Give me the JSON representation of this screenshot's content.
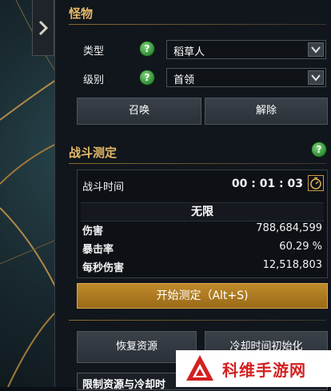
{
  "monster": {
    "title": "怪物",
    "type_label": "类型",
    "type_value": "稻草人",
    "level_label": "级别",
    "level_value": "首领",
    "help_glyph": "?",
    "summon_label": "召唤",
    "dismiss_label": "解除"
  },
  "combat": {
    "title": "战斗测定",
    "help_glyph": "?",
    "time_label": "战斗时间",
    "time_value": "00 : 01 : 03",
    "mode": "无限",
    "damage_label": "伤害",
    "damage_value": "788,684,599",
    "crit_label": "暴击率",
    "crit_value": "60.29 %",
    "dps_label": "每秒伤害",
    "dps_value": "12,518,803",
    "start_label": "开始测定（Alt+S)"
  },
  "actions": {
    "restore_label": "恢复资源",
    "cooldown_label": "冷却时间初始化",
    "limit_label": "限制资源与冷却时"
  },
  "watermark": {
    "text": "科维手游网"
  },
  "colors": {
    "accent": "#e7b968",
    "gold_button": "#b07e22",
    "help_green": "#3aa03f"
  },
  "icons": {
    "collapse": "chevron-right-icon",
    "help": "question-icon",
    "dropdown": "chevron-down-icon",
    "timer": "stopwatch-icon"
  }
}
